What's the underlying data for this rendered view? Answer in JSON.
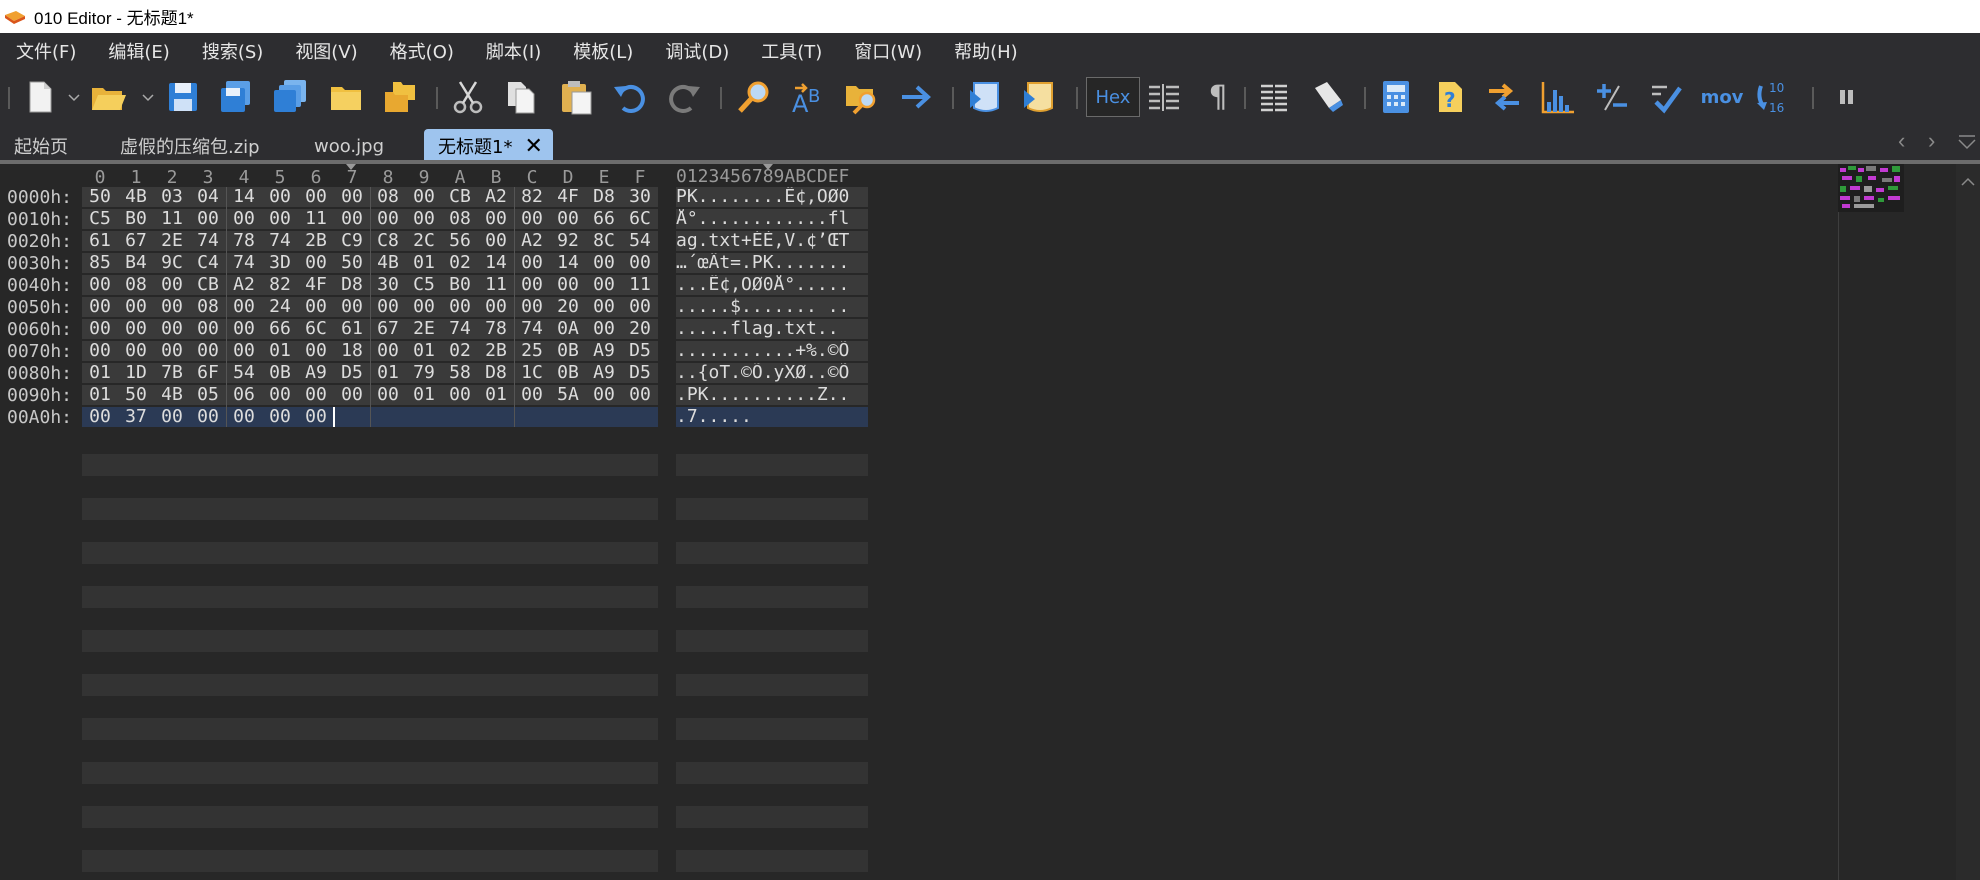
{
  "window": {
    "title": "010 Editor - 无标题1*"
  },
  "menu": [
    "文件(F)",
    "编辑(E)",
    "搜索(S)",
    "视图(V)",
    "格式(O)",
    "脚本(I)",
    "模板(L)",
    "调试(D)",
    "工具(T)",
    "窗口(W)",
    "帮助(H)"
  ],
  "toolbar": {
    "hex_label": "Hex",
    "mov_label": "mov",
    "base_top": "10",
    "base_bottom": "16"
  },
  "tabs": [
    {
      "label": "起始页"
    },
    {
      "label": "虚假的压缩包.zip"
    },
    {
      "label": "woo.jpg"
    },
    {
      "label": "无标题1*",
      "close": "✕"
    }
  ],
  "hex": {
    "col_headers": [
      "0",
      "1",
      "2",
      "3",
      "4",
      "5",
      "6",
      "7",
      "8",
      "9",
      "A",
      "B",
      "C",
      "D",
      "E",
      "F"
    ],
    "ascii_header": "0123456789ABCDEF",
    "rows": [
      {
        "addr": "0000h:",
        "bytes": [
          "50",
          "4B",
          "03",
          "04",
          "14",
          "00",
          "00",
          "00",
          "08",
          "00",
          "CB",
          "A2",
          "82",
          "4F",
          "D8",
          "30"
        ],
        "ascii": "PK........Ë¢‚OØ0"
      },
      {
        "addr": "0010h:",
        "bytes": [
          "C5",
          "B0",
          "11",
          "00",
          "00",
          "00",
          "11",
          "00",
          "00",
          "00",
          "08",
          "00",
          "00",
          "00",
          "66",
          "6C"
        ],
        "ascii": "Å°............fl"
      },
      {
        "addr": "0020h:",
        "bytes": [
          "61",
          "67",
          "2E",
          "74",
          "78",
          "74",
          "2B",
          "C9",
          "C8",
          "2C",
          "56",
          "00",
          "A2",
          "92",
          "8C",
          "54"
        ],
        "ascii": "ag.txt+ÉÈ,V.¢’ŒT"
      },
      {
        "addr": "0030h:",
        "bytes": [
          "85",
          "B4",
          "9C",
          "C4",
          "74",
          "3D",
          "00",
          "50",
          "4B",
          "01",
          "02",
          "14",
          "00",
          "14",
          "00",
          "00"
        ],
        "ascii": "…´œÄt=.PK......."
      },
      {
        "addr": "0040h:",
        "bytes": [
          "00",
          "08",
          "00",
          "CB",
          "A2",
          "82",
          "4F",
          "D8",
          "30",
          "C5",
          "B0",
          "11",
          "00",
          "00",
          "00",
          "11"
        ],
        "ascii": "...Ë¢‚OØ0Å°....."
      },
      {
        "addr": "0050h:",
        "bytes": [
          "00",
          "00",
          "00",
          "08",
          "00",
          "24",
          "00",
          "00",
          "00",
          "00",
          "00",
          "00",
          "00",
          "20",
          "00",
          "00"
        ],
        "ascii": ".....$....... .."
      },
      {
        "addr": "0060h:",
        "bytes": [
          "00",
          "00",
          "00",
          "00",
          "00",
          "66",
          "6C",
          "61",
          "67",
          "2E",
          "74",
          "78",
          "74",
          "0A",
          "00",
          "20"
        ],
        "ascii": ".....flag.txt.. "
      },
      {
        "addr": "0070h:",
        "bytes": [
          "00",
          "00",
          "00",
          "00",
          "00",
          "01",
          "00",
          "18",
          "00",
          "01",
          "02",
          "2B",
          "25",
          "0B",
          "A9",
          "D5"
        ],
        "ascii": "...........+%.©Õ"
      },
      {
        "addr": "0080h:",
        "bytes": [
          "01",
          "1D",
          "7B",
          "6F",
          "54",
          "0B",
          "A9",
          "D5",
          "01",
          "79",
          "58",
          "D8",
          "1C",
          "0B",
          "A9",
          "D5"
        ],
        "ascii": "..{oT.©Õ.yXØ..©Õ"
      },
      {
        "addr": "0090h:",
        "bytes": [
          "01",
          "50",
          "4B",
          "05",
          "06",
          "00",
          "00",
          "00",
          "00",
          "01",
          "00",
          "01",
          "00",
          "5A",
          "00",
          "00"
        ],
        "ascii": ".PK..........Z.."
      },
      {
        "addr": "00A0h:",
        "bytes": [
          "00",
          "37",
          "00",
          "00",
          "00",
          "00",
          "00"
        ],
        "ascii": ".7....."
      }
    ]
  }
}
